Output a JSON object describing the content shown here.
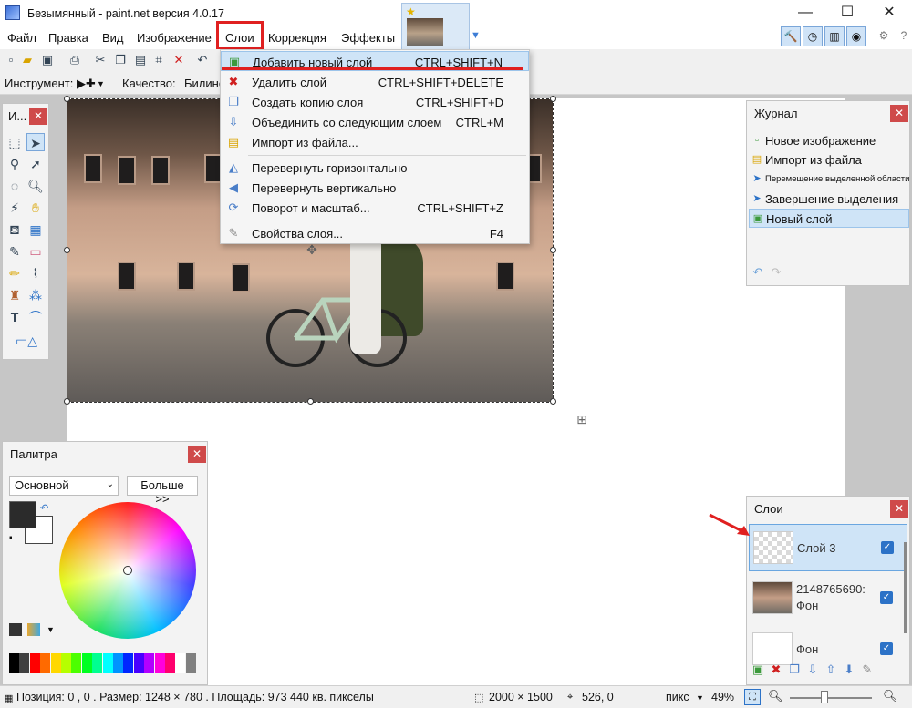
{
  "window": {
    "title": "Безымянный - paint.net версия 4.0.17",
    "minimize": "—",
    "maximize": "☐",
    "close": "✕"
  },
  "menu": {
    "file": "Файл",
    "edit": "Правка",
    "view": "Вид",
    "image": "Изображение",
    "layers": "Слои",
    "adjustments": "Коррекция",
    "effects": "Эффекты"
  },
  "toolbar": {
    "tool_label": "Инструмент:",
    "quality_label": "Качество:",
    "quality_value": "Билине"
  },
  "layers_menu": {
    "items": [
      {
        "icon": "add-layer-icon",
        "glyph": "▣",
        "color": "#3c9a3c",
        "label": "Добавить новый слой",
        "shortcut": "CTRL+SHIFT+N"
      },
      {
        "icon": "delete-layer-icon",
        "glyph": "✖",
        "color": "#d02020",
        "label": "Удалить слой",
        "shortcut": "CTRL+SHIFT+DELETE"
      },
      {
        "icon": "duplicate-layer-icon",
        "glyph": "❐",
        "color": "#4a7ec8",
        "label": "Создать копию слоя",
        "shortcut": "CTRL+SHIFT+D"
      },
      {
        "icon": "merge-down-icon",
        "glyph": "⇩",
        "color": "#4a7ec8",
        "label": "Объединить со следующим слоем",
        "shortcut": "CTRL+M"
      },
      {
        "icon": "import-file-icon",
        "glyph": "▤",
        "color": "#d9a400",
        "label": "Импорт из файла...",
        "shortcut": ""
      },
      {
        "icon": "flip-horizontal-icon",
        "glyph": "◭",
        "color": "#4a7ec8",
        "label": "Перевернуть горизонтально",
        "shortcut": ""
      },
      {
        "icon": "flip-vertical-icon",
        "glyph": "◀",
        "color": "#4a7ec8",
        "label": "Перевернуть вертикально",
        "shortcut": ""
      },
      {
        "icon": "rotate-zoom-icon",
        "glyph": "⟳",
        "color": "#4a7ec8",
        "label": "Поворот и масштаб...",
        "shortcut": "CTRL+SHIFT+Z"
      },
      {
        "icon": "layer-properties-icon",
        "glyph": "✎",
        "color": "#888888",
        "label": "Свойства слоя...",
        "shortcut": "F4"
      }
    ]
  },
  "tools_panel": {
    "title": "И..."
  },
  "history": {
    "title": "Журнал",
    "items": [
      {
        "icon": "new-image-icon",
        "label": "Новое изображение"
      },
      {
        "icon": "import-file-icon",
        "label": "Импорт из файла"
      },
      {
        "icon": "move-selection-icon",
        "label": "Перемещение выделенной области"
      },
      {
        "icon": "finish-selection-icon",
        "label": "Завершение выделения"
      },
      {
        "icon": "new-layer-icon",
        "label": "Новый слой"
      }
    ]
  },
  "palette": {
    "title": "Палитра",
    "mode": "Основной",
    "more_button": "Больше >>",
    "primary_color": "#2b2b2b",
    "secondary_color": "#ffffff",
    "swatches": [
      "#000000",
      "#404040",
      "#ff0000",
      "#ff6a00",
      "#ffd800",
      "#b6ff00",
      "#4cff00",
      "#00ff21",
      "#00ff90",
      "#00ffff",
      "#0094ff",
      "#0026ff",
      "#4800ff",
      "#b200ff",
      "#ff00dc",
      "#ff006e",
      "#ffffff",
      "#808080"
    ]
  },
  "layers_panel": {
    "title": "Слои",
    "layers": [
      {
        "name": "Слой 3",
        "visible": true,
        "selected": true
      },
      {
        "name_line1": "2148765690:",
        "name_line2": "Фон",
        "visible": true,
        "selected": false
      },
      {
        "name": "Фон",
        "visible": true,
        "selected": false
      }
    ]
  },
  "status": {
    "position": "Позиция: 0 , 0 . Размер: 1248 × 780 . Площадь: 973 440 кв. пикселы",
    "image_size": "2000 × 1500",
    "cursor": "526, 0",
    "units": "пикс",
    "zoom": "49%"
  },
  "colors": {
    "highlight_red": "#e02020",
    "accent_blue": "#2c72c7",
    "selection_blue": "#cfe4f7"
  }
}
